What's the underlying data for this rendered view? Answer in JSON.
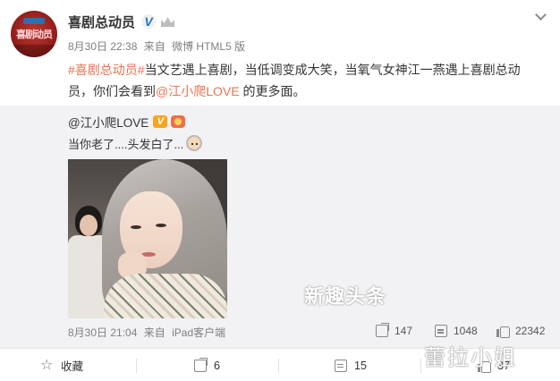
{
  "post": {
    "author": "喜剧总动员",
    "date": "8月30日 22:38",
    "from": "来自",
    "client": "微博 HTML5 版",
    "text_line1_topic": "#喜剧总动员#",
    "text_line1_rest": "当文艺遇上喜剧，当低调变成大笑，当氧气女神江一燕遇上喜剧总动",
    "text_line2_pre": "员，你们会看到",
    "text_line2_mention": "@江小爬LOVE",
    "text_line2_post": " 的更多面。",
    "avatar_logo": "喜剧动员"
  },
  "repost": {
    "author": "@江小爬LOVE",
    "text": "当你老了....头发白了...",
    "date": "8月30日 21:04",
    "from": "来自",
    "client": "iPad客户端",
    "watermark": "新趣头条",
    "stats": {
      "shares": "147",
      "comments": "1048",
      "likes": "22342"
    }
  },
  "actions": {
    "favorite_label": "收藏",
    "share_count": "6",
    "comment_count": "15",
    "like_count": "37"
  },
  "bottom_watermark": "蕾拉小姐",
  "colors": {
    "link": "#eb7350",
    "verified": "#1f78d6",
    "repost_bg": "#f2f2f5"
  },
  "icons": [
    "verified-icon",
    "member-crown-icon",
    "chevron-down-icon",
    "orange-v-icon",
    "fan-icon",
    "granny-emoji-icon",
    "share-icon",
    "comment-icon",
    "like-icon",
    "star-icon"
  ]
}
